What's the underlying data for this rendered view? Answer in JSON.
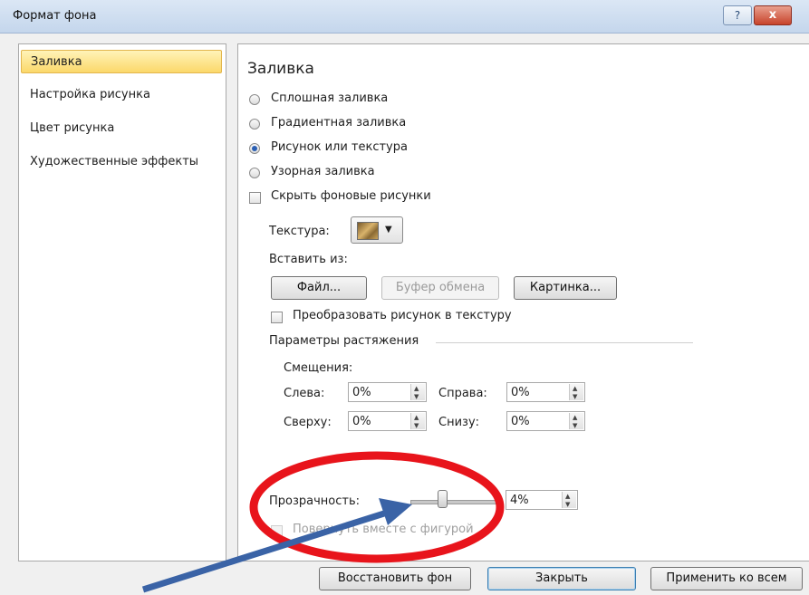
{
  "window": {
    "title": "Формат фона",
    "help_label": "?",
    "close_label": "x"
  },
  "nav": {
    "items": [
      "Заливка",
      "Настройка рисунка",
      "Цвет рисунка",
      "Художественные эффекты"
    ],
    "selected_index": 0
  },
  "panel": {
    "title": "Заливка",
    "fill_options": [
      {
        "label": "Сплошная заливка",
        "checked": false
      },
      {
        "label": "Градиентная заливка",
        "checked": false
      },
      {
        "label": "Рисунок или текстура",
        "checked": true
      },
      {
        "label": "Узорная заливка",
        "checked": false
      }
    ],
    "hide_bg_label": "Скрыть фоновые рисунки",
    "texture_label": "Текстура:",
    "insert_from_label": "Вставить из:",
    "btn_file": "Файл...",
    "btn_clipboard": "Буфер обмена",
    "btn_clipart": "Картинка...",
    "tile_label": "Преобразовать рисунок в текстуру",
    "stretch_label": "Параметры растяжения",
    "offsets_label": "Смещения:",
    "left_label": "Слева:",
    "left_value": "0%",
    "right_label": "Справа:",
    "right_value": "0%",
    "top_label": "Сверху:",
    "top_value": "0%",
    "bottom_label": "Снизу:",
    "bottom_value": "0%",
    "transparency_label": "Прозрачность:",
    "transparency_value": "4%",
    "rotate_label": "Повернуть вместе с фигурой"
  },
  "footer": {
    "reset": "Восстановить фон",
    "close": "Закрыть",
    "apply_all": "Применить ко всем"
  },
  "colors": {
    "annotation_ellipse": "#e8141b",
    "annotation_arrow": "#3a63a6"
  }
}
